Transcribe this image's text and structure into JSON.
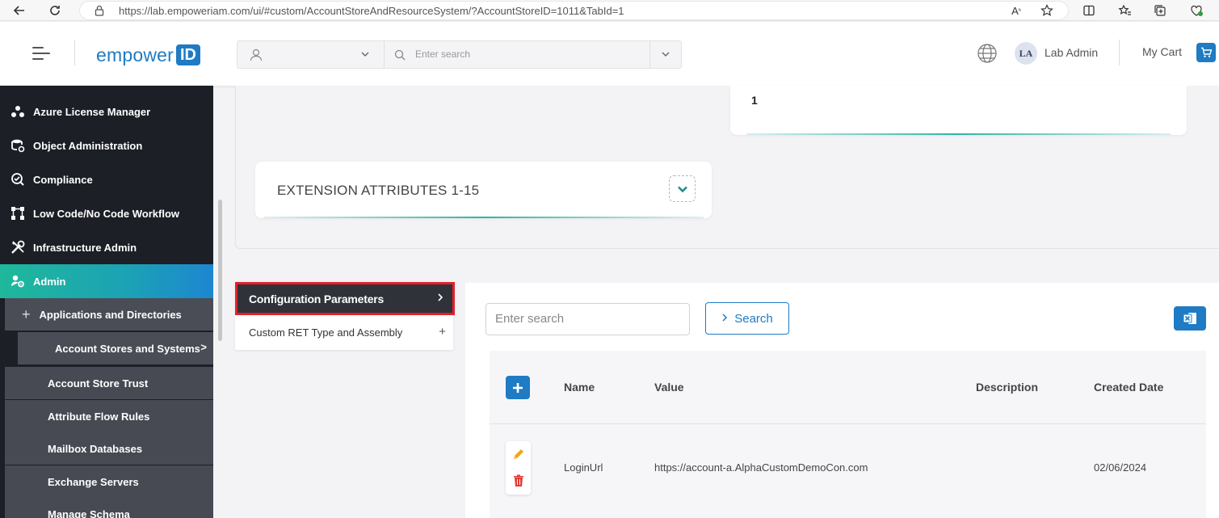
{
  "browser": {
    "url": "https://lab.empoweriam.com/ui/#custom/AccountStoreAndResourceSystem/?AccountStoreID=1011&TabId=1"
  },
  "header": {
    "logo_text": "empower",
    "logo_id": "ID",
    "search_placeholder": "Enter search",
    "user_initials": "LA",
    "user_name": "Lab Admin",
    "cart_label": "My Cart"
  },
  "sidebar": {
    "items": [
      {
        "label": "Azure License Manager",
        "icon": "azure-license-icon"
      },
      {
        "label": "Object Administration",
        "icon": "object-admin-icon"
      },
      {
        "label": "Compliance",
        "icon": "compliance-icon"
      },
      {
        "label": "Low Code/No Code Workflow",
        "icon": "workflow-icon"
      },
      {
        "label": "Infrastructure Admin",
        "icon": "tools-icon"
      },
      {
        "label": "Admin",
        "icon": "admin-icon"
      }
    ],
    "sub_group": "Applications and Directories",
    "sub_active": "Account Stores and Systems",
    "sub_items": [
      "Account Store Trust",
      "Attribute Flow Rules",
      "Mailbox Databases",
      "Exchange Servers",
      "Manage Schema"
    ]
  },
  "main": {
    "value_card_value": "1",
    "ext_title": "EXTENSION ATTRIBUTES 1-15",
    "left_menu": {
      "active": "Configuration Parameters",
      "item": "Custom RET Type and Assembly"
    },
    "grid": {
      "search_placeholder": "Enter search",
      "search_button": "Search",
      "columns": [
        "Name",
        "Value",
        "Description",
        "Created Date"
      ],
      "rows": [
        {
          "name": "LoginUrl",
          "value": "https://account-a.AlphaCustomDemoCon.com",
          "description": "",
          "created": "02/06/2024"
        }
      ]
    }
  },
  "colors": {
    "brand": "#1e7bc4",
    "sidebar_bg": "#1c1f26",
    "highlight_border": "#e3202b"
  }
}
